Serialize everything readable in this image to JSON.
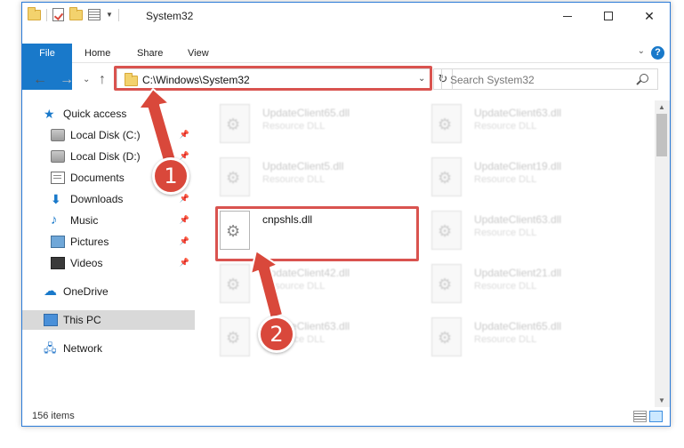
{
  "window": {
    "title": "System32"
  },
  "ribbon": {
    "tabs": [
      {
        "label": "File"
      },
      {
        "label": "Home"
      },
      {
        "label": "Share"
      },
      {
        "label": "View"
      }
    ],
    "help_label": "?"
  },
  "navigation": {
    "address": "C:\\Windows\\System32",
    "search_placeholder": "Search System32"
  },
  "sidebar": {
    "items": [
      {
        "label": "Quick access",
        "icon": "star-icon",
        "pinned": false
      },
      {
        "label": "Local Disk (C:)",
        "icon": "drive-icon",
        "pinned": true
      },
      {
        "label": "Local Disk (D:)",
        "icon": "drive-icon",
        "pinned": true
      },
      {
        "label": "Documents",
        "icon": "documents-icon",
        "pinned": true
      },
      {
        "label": "Downloads",
        "icon": "download-icon",
        "pinned": true
      },
      {
        "label": "Music",
        "icon": "music-icon",
        "pinned": true
      },
      {
        "label": "Pictures",
        "icon": "pictures-icon",
        "pinned": true
      },
      {
        "label": "Videos",
        "icon": "videos-icon",
        "pinned": true
      },
      {
        "label": "OneDrive",
        "icon": "cloud-icon",
        "pinned": false
      },
      {
        "label": "This PC",
        "icon": "computer-icon",
        "pinned": false,
        "selected": true
      },
      {
        "label": "Network",
        "icon": "network-icon",
        "pinned": false
      }
    ]
  },
  "files": [
    {
      "name": "UpdateClient65.dll",
      "type": "Resource DLL"
    },
    {
      "name": "UpdateClient63.dll",
      "type": "Resource DLL"
    },
    {
      "name": "UpdateClient5.dll",
      "type": "Resource DLL"
    },
    {
      "name": "UpdateClient19.dll",
      "type": "Resource DLL"
    },
    {
      "name": "cnpshls.dll",
      "type": "",
      "focused": true
    },
    {
      "name": "UpdateClient63.dll",
      "type": "Resource DLL"
    },
    {
      "name": "UpdateClient42.dll",
      "type": "Resource DLL"
    },
    {
      "name": "UpdateClient21.dll",
      "type": "Resource DLL"
    },
    {
      "name": "UpdateClient63.dll",
      "type": "Resource DLL"
    },
    {
      "name": "UpdateClient65.dll",
      "type": "Resource DLL"
    }
  ],
  "status": {
    "item_count": "156 items"
  },
  "annotations": {
    "step1": "1",
    "step2": "2",
    "color": "#d9483b"
  }
}
